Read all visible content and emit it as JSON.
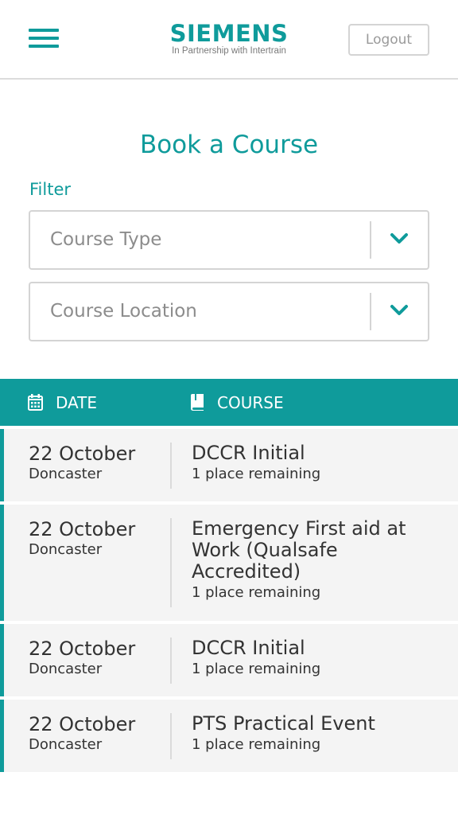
{
  "header": {
    "logo": "SIEMENS",
    "logo_subtitle": "In Partnership with Intertrain",
    "logout_label": "Logout"
  },
  "page": {
    "title": "Book a Course",
    "filter_label": "Filter"
  },
  "filters": {
    "course_type_placeholder": "Course Type",
    "course_location_placeholder": "Course Location"
  },
  "table": {
    "date_header": "DATE",
    "course_header": "COURSE",
    "rows": [
      {
        "date": "22 October",
        "location": "Doncaster",
        "course": "DCCR Initial",
        "places": "1 place remaining"
      },
      {
        "date": "22 October",
        "location": "Doncaster",
        "course": "Emergency First aid at Work (Qualsafe Accredited)",
        "places": "1 place remaining"
      },
      {
        "date": "22 October",
        "location": "Doncaster",
        "course": "DCCR Initial",
        "places": "1 place remaining"
      },
      {
        "date": "22 October",
        "location": "Doncaster",
        "course": "PTS Practical Event",
        "places": "1 place remaining"
      }
    ]
  },
  "colors": {
    "accent": "#0f9b9b",
    "row_background": "#f4f4f4",
    "border": "#d4d4d4"
  },
  "icons": {
    "menu": "hamburger-menu-icon",
    "dropdown": "chevron-down-icon",
    "date": "calendar-icon",
    "course": "book-icon"
  }
}
